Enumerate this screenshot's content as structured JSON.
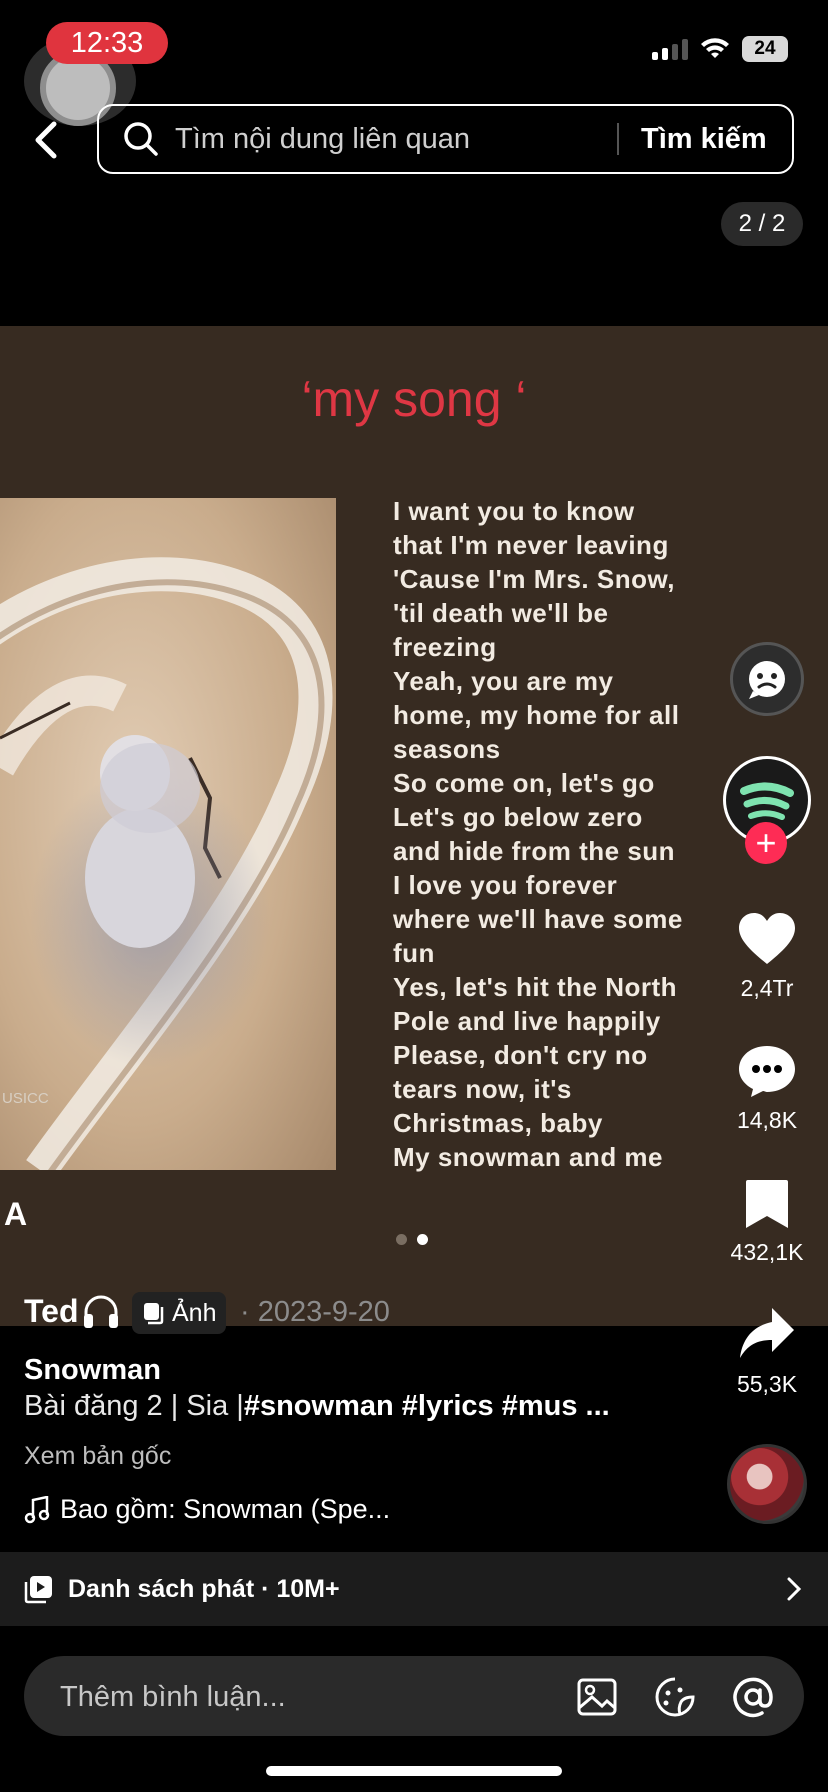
{
  "status": {
    "time": "12:33",
    "battery": "24"
  },
  "search": {
    "placeholder": "Tìm nội dung liên quan",
    "button": "Tìm kiếm"
  },
  "pager": "2 / 2",
  "post": {
    "song_title": "‘my song ‘",
    "lyrics": [
      "I want you to know",
      "that I'm never leaving",
      "'Cause I'm Mrs. Snow,",
      "'til death we'll be",
      "freezing",
      "Yeah, you are my",
      "home, my home for all",
      "seasons",
      "So come on, let's go",
      "Let's go below zero",
      "and hide from the sun",
      "I love you forever",
      "where we'll have some",
      "fun",
      "Yes, let's hit the North",
      "Pole and live happily",
      "Please, don't cry no",
      "tears now, it's",
      "Christmas, baby",
      "My snowman and me"
    ],
    "watermark": "USICC",
    "overlay_letter": "A",
    "slide_index": 2,
    "slide_count": 2
  },
  "rail": {
    "likes": "2,4Tr",
    "comments": "14,8K",
    "saves": "432,1K",
    "shares": "55,3K"
  },
  "info": {
    "author": "Ted",
    "type_badge": "Ảnh",
    "date": "· 2023-9-20",
    "title": "Snowman",
    "caption_prefix": "Bài đăng 2 | Sia |",
    "caption_tags": "#snowman #lyrics #mus ...",
    "see_original": "Xem bản gốc",
    "music": "Bao gồm: Snowman (Spe..."
  },
  "playlist": {
    "label": "Danh sách phát · 10M+"
  },
  "comment": {
    "placeholder": "Thêm bình luận..."
  },
  "colors": {
    "accent": "#fe2c55",
    "title_red": "#df3744",
    "card_bg": "#372b21"
  }
}
